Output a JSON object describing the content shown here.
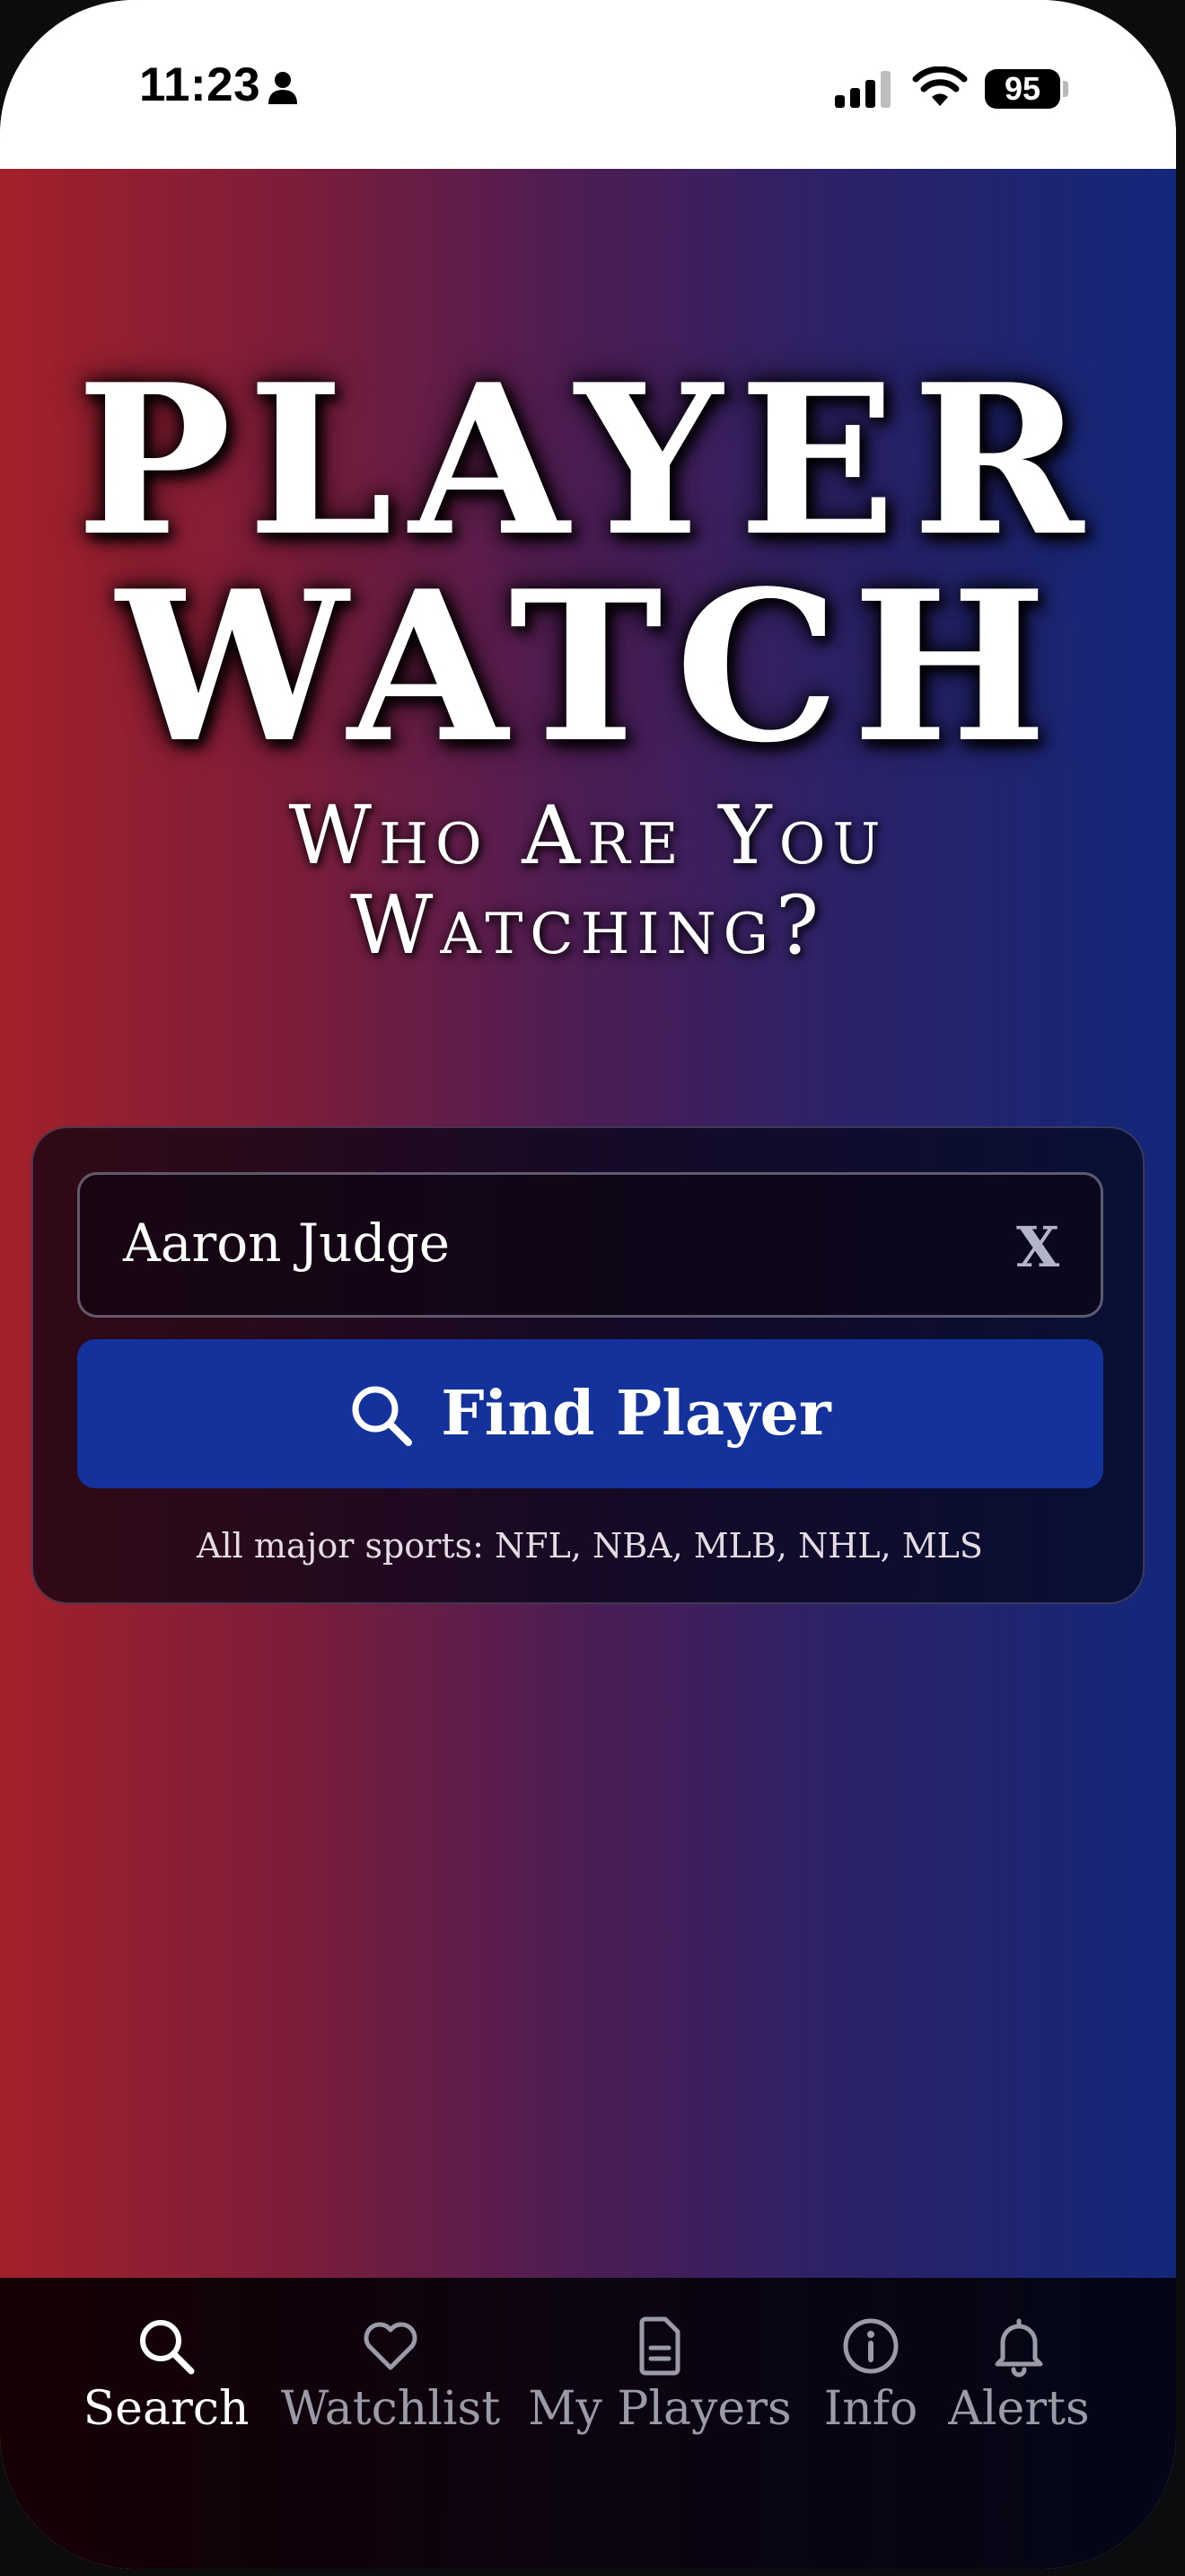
{
  "status_bar": {
    "time": "11:23",
    "battery": "95",
    "icons": [
      "person-icon",
      "signal-icon",
      "wifi-icon",
      "battery-icon"
    ]
  },
  "header": {
    "title_line1": "PLAYER",
    "title_line2": "WATCH",
    "subtitle_line1": "Who Are You",
    "subtitle_line2": "Watching?"
  },
  "search": {
    "value": "Aaron Judge",
    "clear_label": "X",
    "button_label": "Find Player",
    "button_icon": "search-icon",
    "note": "All major sports: NFL, NBA, MLB, NHL, MLS"
  },
  "nav": {
    "items": [
      {
        "label": "Search",
        "icon": "search-icon",
        "active": true
      },
      {
        "label": "Watchlist",
        "icon": "heart-icon",
        "active": false
      },
      {
        "label": "My Players",
        "icon": "document-icon",
        "active": false
      },
      {
        "label": "Info",
        "icon": "info-icon",
        "active": false
      },
      {
        "label": "Alerts",
        "icon": "bell-icon",
        "active": false
      }
    ]
  },
  "colors": {
    "gradient_left": "#a3202a",
    "gradient_mid": "#4b1d55",
    "gradient_right": "#13277a",
    "button": "#13329b",
    "nav_active": "#ffffff",
    "nav_inactive": "#9a9aa8"
  }
}
